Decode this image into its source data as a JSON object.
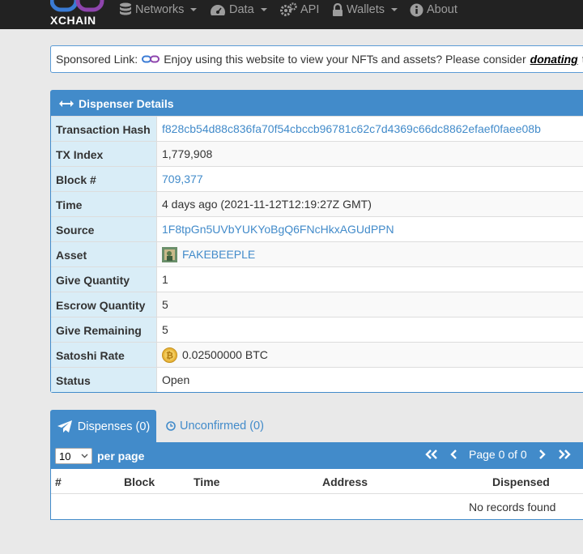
{
  "nav": {
    "logo_text": "XCHAIN",
    "items": [
      {
        "label": "Networks",
        "icon": "database-icon",
        "dropdown": true
      },
      {
        "label": "Data",
        "icon": "dashboard-icon",
        "dropdown": true
      },
      {
        "label": "API",
        "icon": "gears-icon",
        "dropdown": false
      },
      {
        "label": "Wallets",
        "icon": "lock-icon",
        "dropdown": true
      },
      {
        "label": "About",
        "icon": "info-icon",
        "dropdown": false
      }
    ]
  },
  "sponsor": {
    "prefix": "Sponsored Link:",
    "text": "Enjoy using this website to view your NFTs and assets? Please consider",
    "link": "donating",
    "suffix": "to"
  },
  "details": {
    "title": "Dispenser Details",
    "rows": [
      {
        "key": "Transaction Hash",
        "value": "f828cb54d88c836fa70f54cbccb96781c62c7d4369c66dc8862efaef0faee08b"
      },
      {
        "key": "TX Index",
        "value": "1,779,908"
      },
      {
        "key": "Block #",
        "value": "709,377"
      },
      {
        "key": "Time",
        "value": "4 days ago (2021-11-12T12:19:27Z GMT)"
      },
      {
        "key": "Source",
        "value": "1F8tpGn5UVbYUKYoBgQ6FNcHkxAGUdPPN"
      },
      {
        "key": "Asset",
        "value": "FAKEBEEPLE"
      },
      {
        "key": "Give Quantity",
        "value": "1"
      },
      {
        "key": "Escrow Quantity",
        "value": "5"
      },
      {
        "key": "Give Remaining",
        "value": "5"
      },
      {
        "key": "Satoshi Rate",
        "value": "0.02500000 BTC"
      },
      {
        "key": "Status",
        "value": "Open"
      }
    ]
  },
  "tabs": {
    "active": "Dispenses (0)",
    "other": "Unconfirmed (0)"
  },
  "table": {
    "per_page_value": "10",
    "per_page_label": "per page",
    "page_text": "Page 0 of 0",
    "columns": [
      "#",
      "Block",
      "Time",
      "Address",
      "Dispensed"
    ],
    "empty_text": "No records found"
  },
  "colors": {
    "primary": "#428bca",
    "label_bg": "#d9edf7",
    "nav_bg": "#222222"
  }
}
